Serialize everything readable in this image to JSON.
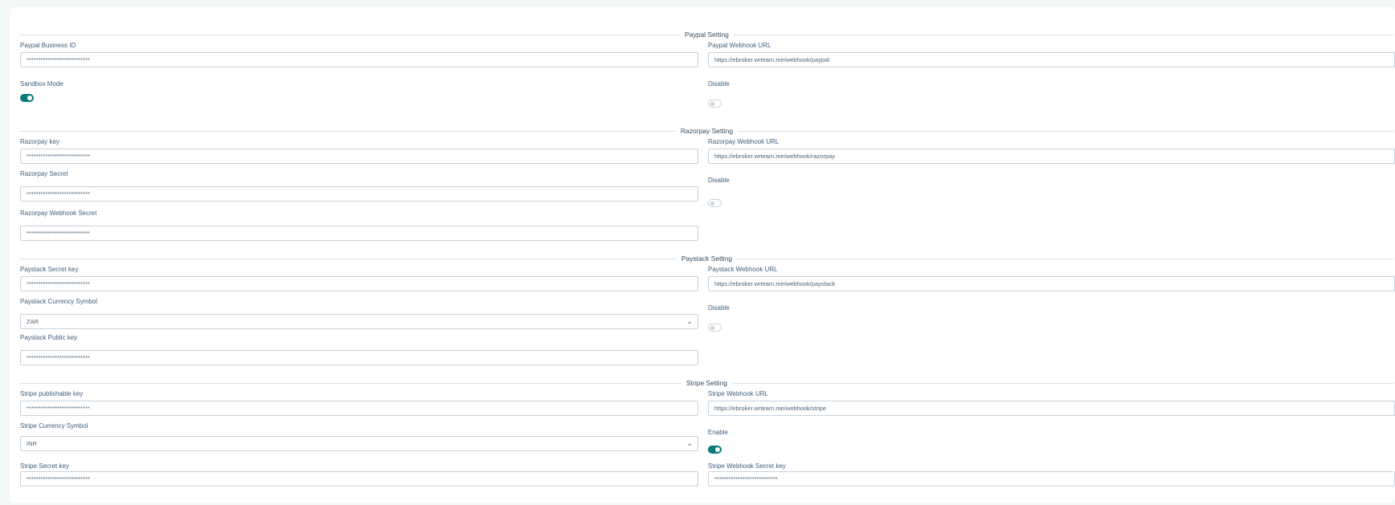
{
  "paypal": {
    "title": "Paypal Setting",
    "business_id_label": "Paypal Business ID",
    "business_id_value": "***************************",
    "webhook_url_label": "Paypal Webhook URL",
    "webhook_url_value": "https://ebroker.wrteam.me/webhook/paypal",
    "sandbox_label": "Sandbox Mode",
    "status_label": "Disable"
  },
  "razorpay": {
    "title": "Razorpay Setting",
    "key_label": "Razorpay key",
    "key_value": "***************************",
    "webhook_url_label": "Razorpay Webhook URL",
    "webhook_url_value": "https://ebroker.wrteam.me/webhook/razorpay",
    "secret_label": "Razorpay Secret",
    "secret_value": "***************************",
    "status_label": "Disable",
    "webhook_secret_label": "Razorpay Webhook Secret",
    "webhook_secret_value": "***************************"
  },
  "paystack": {
    "title": "Paystack Setting",
    "secret_key_label": "Paystack Secret key",
    "secret_key_value": "***************************",
    "webhook_url_label": "Paystack Webhook URL",
    "webhook_url_value": "https://ebroker.wrteam.me/webhook/paystack",
    "currency_label": "Paystack Currency Symbol",
    "currency_value": "ZAR",
    "status_label": "Disable",
    "public_key_label": "Paystack Public key",
    "public_key_value": "***************************"
  },
  "stripe": {
    "title": "Stripe Setting",
    "publishable_key_label": "Stripe publishable key",
    "publishable_key_value": "***************************",
    "webhook_url_label": "Stripe Webhook URL",
    "webhook_url_value": "https://ebroker.wrteam.me/webhook/stripe",
    "currency_label": "Stripe Currency Symbol",
    "currency_value": "INR",
    "status_label": "Enable",
    "secret_key_label": "Stripe Secret key",
    "secret_key_value": "***************************",
    "webhook_secret_label": "Stripe Webhook Secret key",
    "webhook_secret_value": "***************************"
  },
  "toggles": {
    "paypal_sandbox": true,
    "paypal_enabled": false,
    "razorpay_enabled": false,
    "paystack_enabled": false,
    "stripe_enabled": true
  },
  "colors": {
    "accent": "#087c7a",
    "page_bg": "#f2f7f8",
    "label": "#3d6080"
  },
  "icons": {
    "select_chevron": "chevron-down-icon"
  }
}
